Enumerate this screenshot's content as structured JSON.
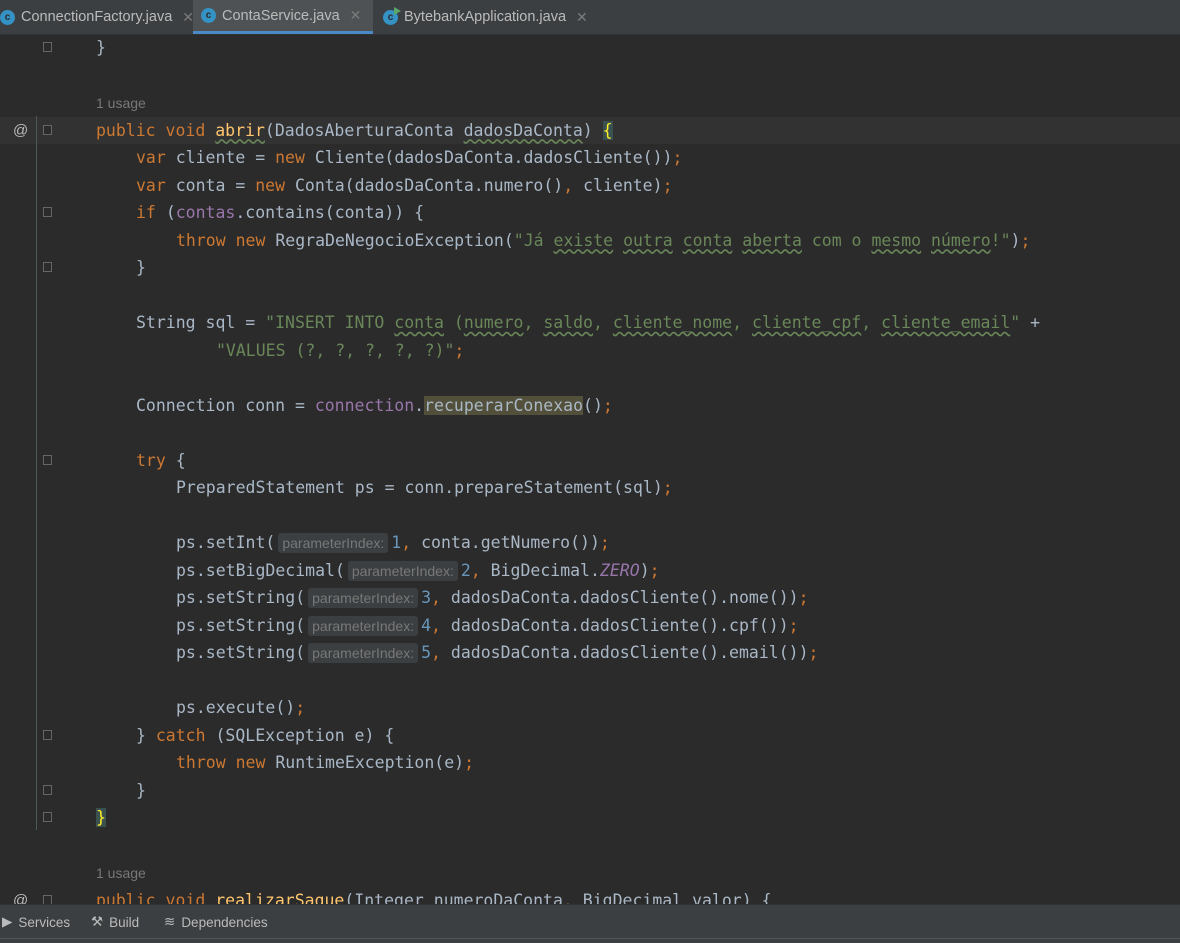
{
  "tabs": [
    {
      "label": "ConnectionFactory.java",
      "icon": "class-icon",
      "active": false
    },
    {
      "label": "ContaService.java",
      "icon": "class-icon",
      "active": true
    },
    {
      "label": "BytebankApplication.java",
      "icon": "runnable-class-icon",
      "active": false
    }
  ],
  "colors": {
    "background": "#2b2b2b",
    "keyword": "#cc7832",
    "string": "#6a8759",
    "method": "#ffc66d",
    "field": "#9876aa",
    "number": "#6897bb",
    "text": "#a9b7c6",
    "accent": "#4a88c7"
  },
  "editor": {
    "lines": [
      {
        "i": 1,
        "fold": true,
        "t": [
          [
            "}",
            ""
          ]
        ]
      },
      {
        "t": []
      },
      {
        "i": 1,
        "t": [
          [
            "1 usage",
            "usage"
          ]
        ]
      },
      {
        "i": 1,
        "cur": true,
        "gm": "@",
        "fold": true,
        "t": [
          [
            "public void ",
            "k"
          ],
          [
            "abrir",
            "m mu"
          ],
          [
            "(DadosAberturaConta ",
            ""
          ],
          [
            "dadosDaConta",
            "mu"
          ],
          [
            ") ",
            ""
          ],
          [
            "{",
            "bh"
          ]
        ]
      },
      {
        "i": 2,
        "t": [
          [
            "var ",
            "k"
          ],
          [
            "cliente = ",
            ""
          ],
          [
            "new ",
            "k"
          ],
          [
            "Cliente(dadosDaConta.dadosCliente())",
            ""
          ],
          [
            ";",
            "k"
          ]
        ]
      },
      {
        "i": 2,
        "t": [
          [
            "var ",
            "k"
          ],
          [
            "conta = ",
            ""
          ],
          [
            "new ",
            "k"
          ],
          [
            "Conta(dadosDaConta.numero()",
            ""
          ],
          [
            ", ",
            "k"
          ],
          [
            "cliente)",
            ""
          ],
          [
            ";",
            "k"
          ]
        ]
      },
      {
        "i": 2,
        "fold": true,
        "t": [
          [
            "if ",
            "k"
          ],
          [
            "(",
            ""
          ],
          [
            "contas",
            "f"
          ],
          [
            ".contains(conta)) {",
            ""
          ]
        ]
      },
      {
        "i": 3,
        "t": [
          [
            "throw new ",
            "k"
          ],
          [
            "RegraDeNegocioException(",
            ""
          ],
          [
            "\"Já ",
            "s"
          ],
          [
            "existe",
            "s ul"
          ],
          [
            " ",
            "s"
          ],
          [
            "outra",
            "s ul"
          ],
          [
            " ",
            "s"
          ],
          [
            "conta",
            "s ul"
          ],
          [
            " ",
            "s"
          ],
          [
            "aberta",
            "s ul"
          ],
          [
            " com o ",
            "s"
          ],
          [
            "mesmo",
            "s ul"
          ],
          [
            " ",
            "s"
          ],
          [
            "número",
            "s ul"
          ],
          [
            "!\"",
            "s"
          ],
          [
            ")",
            ""
          ],
          [
            ";",
            "k"
          ]
        ]
      },
      {
        "i": 2,
        "fold": true,
        "t": [
          [
            "}",
            ""
          ]
        ]
      },
      {
        "t": []
      },
      {
        "i": 2,
        "t": [
          [
            "String sql = ",
            ""
          ],
          [
            "\"INSERT INTO ",
            "s"
          ],
          [
            "conta",
            "s ul"
          ],
          [
            " (",
            "s"
          ],
          [
            "numero",
            "s ul"
          ],
          [
            ", ",
            "s"
          ],
          [
            "saldo",
            "s ul"
          ],
          [
            ", ",
            "s"
          ],
          [
            "cliente_nome",
            "s ul"
          ],
          [
            ", ",
            "s"
          ],
          [
            "cliente_cpf",
            "s ul"
          ],
          [
            ", ",
            "s"
          ],
          [
            "cliente_email",
            "s ul"
          ],
          [
            "\" ",
            "s"
          ],
          [
            "+",
            ""
          ]
        ]
      },
      {
        "i": 4,
        "t": [
          [
            "\"VALUES (?, ?, ?, ?, ?)\"",
            "s"
          ],
          [
            ";",
            "k"
          ]
        ]
      },
      {
        "t": []
      },
      {
        "i": 2,
        "t": [
          [
            "Connection conn = ",
            ""
          ],
          [
            "connection",
            "f"
          ],
          [
            ".",
            ""
          ],
          [
            "recuperarConexao",
            "hl"
          ],
          [
            "()",
            ""
          ],
          [
            ";",
            "k"
          ]
        ]
      },
      {
        "t": []
      },
      {
        "i": 2,
        "fold": true,
        "t": [
          [
            "try ",
            "k"
          ],
          [
            "{",
            ""
          ]
        ]
      },
      {
        "i": 3,
        "t": [
          [
            "PreparedStatement ps = conn.prepareStatement(sql)",
            ""
          ],
          [
            ";",
            "k"
          ]
        ]
      },
      {
        "t": []
      },
      {
        "i": 3,
        "t": [
          [
            "ps.setInt(",
            ""
          ],
          [
            "parameterIndex:",
            "h"
          ],
          [
            "1",
            "n"
          ],
          [
            ", ",
            "k"
          ],
          [
            "conta.getNumero())",
            ""
          ],
          [
            ";",
            "k"
          ]
        ]
      },
      {
        "i": 3,
        "t": [
          [
            "ps.setBigDecimal(",
            ""
          ],
          [
            "parameterIndex:",
            "h"
          ],
          [
            "2",
            "n"
          ],
          [
            ", ",
            "k"
          ],
          [
            "BigDecimal.",
            ""
          ],
          [
            "ZERO",
            "zi"
          ],
          [
            ")",
            ""
          ],
          [
            ";",
            "k"
          ]
        ]
      },
      {
        "i": 3,
        "t": [
          [
            "ps.setString(",
            ""
          ],
          [
            "parameterIndex:",
            "h"
          ],
          [
            "3",
            "n"
          ],
          [
            ", ",
            "k"
          ],
          [
            "dadosDaConta.dadosCliente().nome())",
            ""
          ],
          [
            ";",
            "k"
          ]
        ]
      },
      {
        "i": 3,
        "t": [
          [
            "ps.setString(",
            ""
          ],
          [
            "parameterIndex:",
            "h"
          ],
          [
            "4",
            "n"
          ],
          [
            ", ",
            "k"
          ],
          [
            "dadosDaConta.dadosCliente().cpf())",
            ""
          ],
          [
            ";",
            "k"
          ]
        ]
      },
      {
        "i": 3,
        "t": [
          [
            "ps.setString(",
            ""
          ],
          [
            "parameterIndex:",
            "h"
          ],
          [
            "5",
            "n"
          ],
          [
            ", ",
            "k"
          ],
          [
            "dadosDaConta.dadosCliente().email())",
            ""
          ],
          [
            ";",
            "k"
          ]
        ]
      },
      {
        "t": []
      },
      {
        "i": 3,
        "t": [
          [
            "ps.execute()",
            ""
          ],
          [
            ";",
            "k"
          ]
        ]
      },
      {
        "i": 2,
        "fold": true,
        "t": [
          [
            "} ",
            ""
          ],
          [
            "catch ",
            "k"
          ],
          [
            "(SQLException e) {",
            ""
          ]
        ]
      },
      {
        "i": 3,
        "t": [
          [
            "throw new ",
            "k"
          ],
          [
            "RuntimeException(e)",
            ""
          ],
          [
            ";",
            "k"
          ]
        ]
      },
      {
        "i": 2,
        "fold": true,
        "t": [
          [
            "}",
            ""
          ]
        ]
      },
      {
        "i": 1,
        "fold": true,
        "t": [
          [
            "}",
            "bh"
          ]
        ]
      },
      {
        "t": []
      },
      {
        "i": 1,
        "t": [
          [
            "1 usage",
            "usage"
          ]
        ]
      },
      {
        "i": 1,
        "gm": "@",
        "fold": true,
        "t": [
          [
            "public void ",
            "k"
          ],
          [
            "realizarSaque",
            "m mu"
          ],
          [
            "(Integer ",
            ""
          ],
          [
            "numeroDaConta",
            ""
          ],
          [
            ", ",
            "k"
          ],
          [
            "BigDecimal ",
            ""
          ],
          [
            "valor",
            ""
          ],
          [
            ") {",
            ""
          ]
        ]
      }
    ]
  },
  "bottom_tools": [
    {
      "label": "Services",
      "icon": "services-icon"
    },
    {
      "label": "Build",
      "icon": "hammer-icon"
    },
    {
      "label": "Dependencies",
      "icon": "dependencies-icon"
    }
  ]
}
